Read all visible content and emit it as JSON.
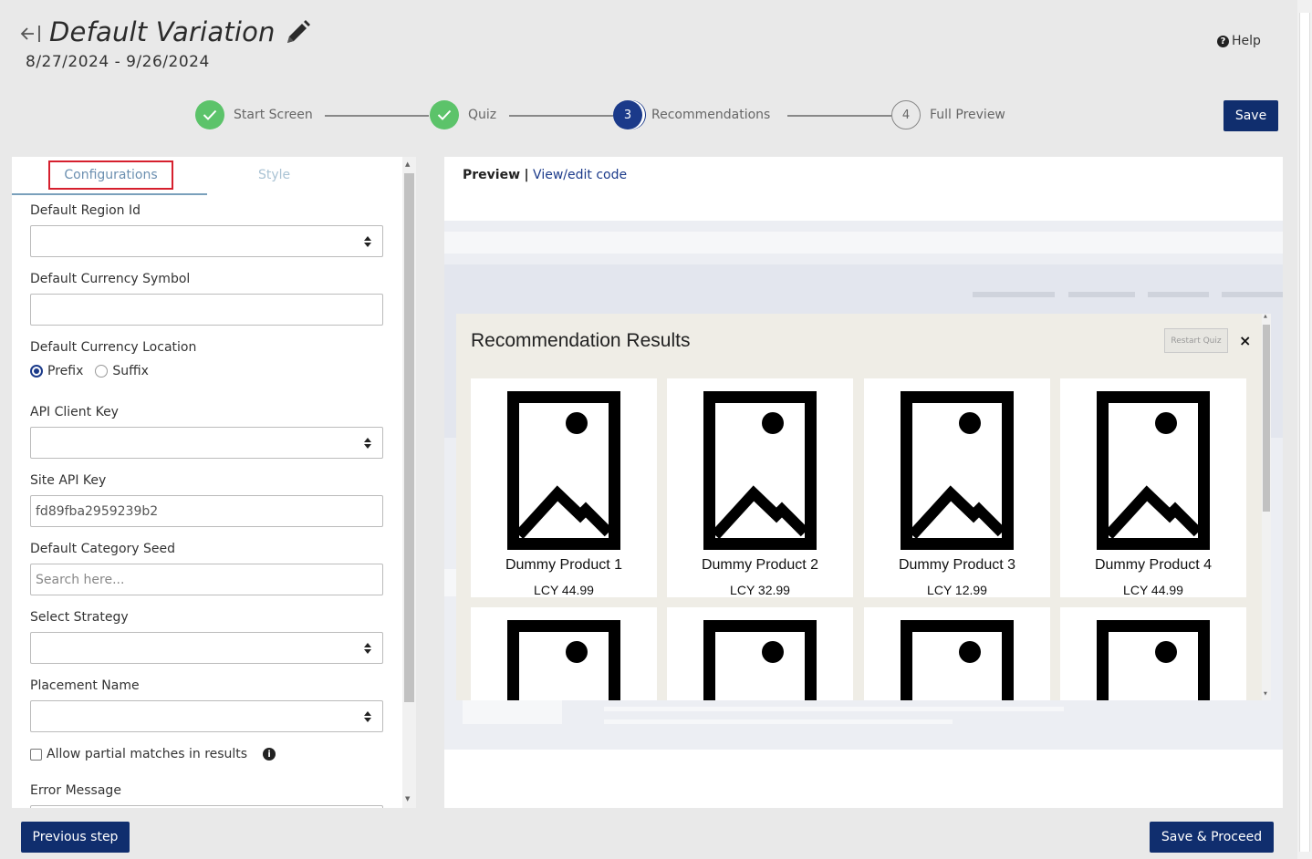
{
  "header": {
    "title": "Default Variation",
    "dates": "8/27/2024 - 9/26/2024",
    "help_label": "Help",
    "save_label": "Save"
  },
  "stepper": {
    "steps": [
      {
        "label": "Start Screen",
        "status": "done"
      },
      {
        "label": "Quiz",
        "status": "done"
      },
      {
        "label": "Recommendations",
        "status": "active",
        "number": "3"
      },
      {
        "label": "Full Preview",
        "status": "todo",
        "number": "4"
      }
    ]
  },
  "left_panel": {
    "tabs": {
      "configurations": "Configurations",
      "style": "Style"
    },
    "fields": {
      "region_label": "Default Region Id",
      "currency_symbol_label": "Default Currency Symbol",
      "currency_location_label": "Default Currency Location",
      "prefix_label": "Prefix",
      "suffix_label": "Suffix",
      "api_client_key_label": "API Client Key",
      "site_api_key_label": "Site API Key",
      "site_api_key_value": "fd89fba2959239b2",
      "category_seed_label": "Default Category Seed",
      "category_seed_placeholder": "Search here...",
      "strategy_label": "Select Strategy",
      "placement_label": "Placement Name",
      "partial_matches_label": "Allow partial matches in results",
      "error_message_label": "Error Message"
    }
  },
  "preview": {
    "tab_preview": "Preview",
    "separator": "|",
    "tab_code": "View/edit code",
    "modal": {
      "title": "Recommendation Results",
      "restart_label": "Restart Quiz",
      "close_glyph": "×",
      "products": [
        {
          "name": "Dummy Product 1",
          "price": "LCY 44.99"
        },
        {
          "name": "Dummy Product 2",
          "price": "LCY 32.99"
        },
        {
          "name": "Dummy Product 3",
          "price": "LCY 12.99"
        },
        {
          "name": "Dummy Product 4",
          "price": "LCY 44.99"
        }
      ]
    }
  },
  "footer": {
    "previous_label": "Previous step",
    "proceed_label": "Save & Proceed"
  },
  "colors": {
    "primary": "#102e6e",
    "done_green": "#5cc36a",
    "highlight_red": "#d6202e"
  }
}
